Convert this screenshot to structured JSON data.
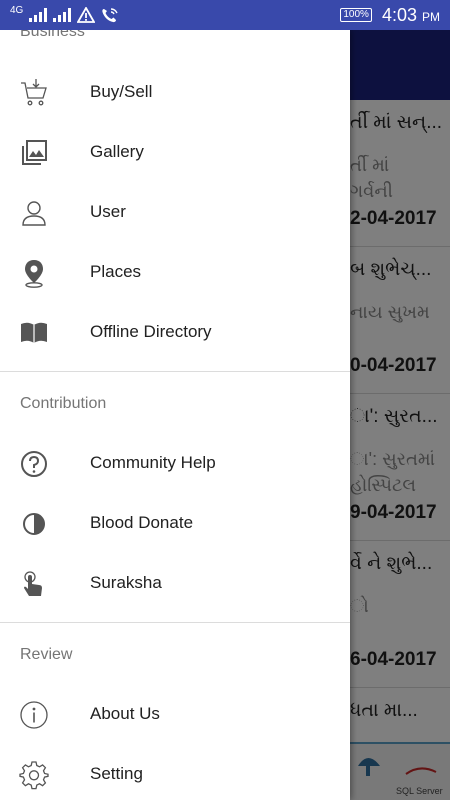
{
  "status_bar": {
    "network": "4G",
    "battery": "100%",
    "time": "4:03",
    "ampm": "PM"
  },
  "drawer": {
    "sections": [
      {
        "title": "Business",
        "items": [
          {
            "label": "Buy/Sell",
            "icon": "cart-icon"
          },
          {
            "label": "Gallery",
            "icon": "gallery-icon"
          },
          {
            "label": "User",
            "icon": "user-icon"
          },
          {
            "label": "Places",
            "icon": "location-pin-icon"
          },
          {
            "label": "Offline Directory",
            "icon": "book-icon"
          }
        ]
      },
      {
        "title": "Contribution",
        "items": [
          {
            "label": "Community Help",
            "icon": "help-icon"
          },
          {
            "label": "Blood Donate",
            "icon": "blood-drop-icon"
          },
          {
            "label": "Suraksha",
            "icon": "touch-icon"
          }
        ]
      },
      {
        "title": "Review",
        "items": [
          {
            "label": "About Us",
            "icon": "info-icon"
          },
          {
            "label": "Setting",
            "icon": "gear-icon"
          }
        ]
      }
    ]
  },
  "background": {
    "items": [
      {
        "title": "ર્તી માં સન્...",
        "subtitle": "ર્તી માં\nગર્વની",
        "date": "2-04-2017"
      },
      {
        "title": "બ શુભેચ્...",
        "subtitle": "નાય સુખમ",
        "date": "0-04-2017"
      },
      {
        "title": "ા': સુરત...",
        "subtitle": "ા': સુરતમાં\nહોસ્પિટલ",
        "date": "9-04-2017"
      },
      {
        "title": "ર્વે ને શુભે...",
        "subtitle": "ો",
        "date": "6-04-2017"
      },
      {
        "title": "ધતા મા...",
        "subtitle": "",
        "date": ""
      }
    ],
    "bottom_label": "SQL Server"
  },
  "colors": {
    "status_bar": "#3949ab",
    "toolbar": "#1a237e"
  }
}
